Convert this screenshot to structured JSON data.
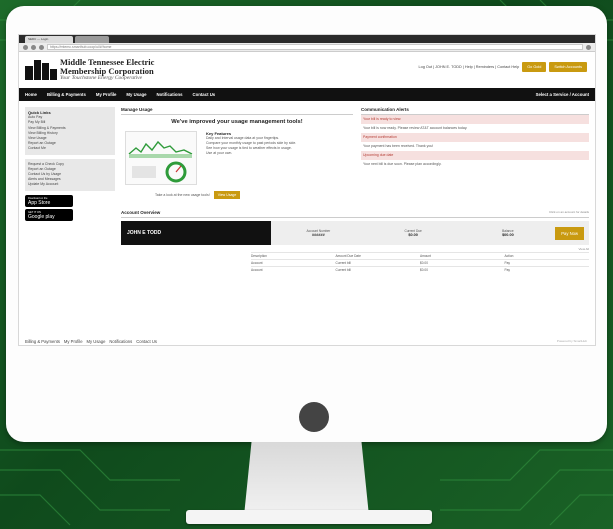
{
  "browser": {
    "tab_title": "SEDC — Login",
    "url": "https://mtemc.smarthub.coop/ui/#/home"
  },
  "header": {
    "logo_line1": "Middle Tennessee Electric",
    "logo_line2": "Membership Corporation",
    "logo_tagline": "Your Touchstone Energy Cooperative",
    "top_links": "Log Out  |  JOHN E. TODD  |  Help  |  Reminders  |  Contact Help",
    "btn_1": "Go Gold",
    "btn_2": "Switch Accounts"
  },
  "nav": {
    "items": [
      "Home",
      "Billing & Payments",
      "My Profile",
      "My Usage",
      "Notifications",
      "Contact Us"
    ],
    "right": "Select a Service / Account"
  },
  "sidebar": {
    "quick_links_title": "Quick Links",
    "quick_links": [
      "Auto Pay",
      "Pay My Bill",
      "View Billing & Payments",
      "View Billing History",
      "View Usage",
      "Report an Outage",
      "Contact Me"
    ],
    "more_links": [
      "Request a Check Copy",
      "Report an Outage",
      "Contact Us by Usage",
      "Alerts and Messages",
      "Update My Account"
    ],
    "app_store": {
      "small": "Download on the",
      "big": "App Store"
    },
    "google_play": {
      "small": "GET IT ON",
      "big": "Google play"
    }
  },
  "usage": {
    "section_title": "Manage Usage",
    "headline": "We've improved your usage management tools!",
    "features_title": "Key Features",
    "features": [
      "Daily and Interval usage data at your fingertips.",
      "Compare your monthly usage to past periods side by side.",
      "See how your usage is tied to weather effects in usage.",
      "Use at your own."
    ],
    "foot_text": "Take a look at the new usage tools!",
    "foot_button": "View Usage"
  },
  "communications": {
    "section_title": "Communication Alerts",
    "lines": [
      "Your bill is ready to view.",
      "Your bill is now ready. Please review AT&T account balances today.",
      "Payment confirmation",
      "Your payment has been received. Thank you!",
      "Upcoming due date",
      "Your next bill is due soon. Please plan accordingly."
    ]
  },
  "account": {
    "section_title": "Account Overview",
    "hint": "Click on an account for details",
    "name": "JOHN E TODD",
    "cells": [
      {
        "label": "Account Number",
        "value": "######"
      },
      {
        "label": "Current Due",
        "value": "$0.00"
      },
      {
        "label": "Balance",
        "value": "$00.00"
      }
    ],
    "pay_button": "Pay Now",
    "view_all": "View All",
    "table_headers": [
      "Description",
      "Amount Due Date",
      "Amount",
      "Action"
    ],
    "table_rows": [
      [
        "Account",
        "Current bill",
        "$0.00",
        "Pay"
      ],
      [
        "Account",
        "Current bill",
        "$0.00",
        "Pay"
      ]
    ]
  },
  "footer": {
    "links": [
      "Billing & Payments",
      "My Profile",
      "My Usage",
      "Notifications",
      "Contact Us"
    ],
    "right": "Powered by SmartHub"
  }
}
